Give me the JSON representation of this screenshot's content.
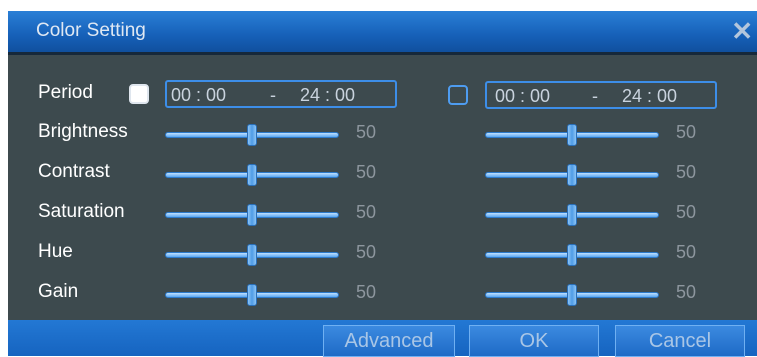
{
  "dialog": {
    "title": "Color Setting",
    "close_glyph": "✕"
  },
  "period": {
    "label": "Period"
  },
  "columns": [
    {
      "checked": true,
      "start": "00 : 00",
      "dash": "-",
      "end": "24 : 00"
    },
    {
      "checked": false,
      "start": "00 : 00",
      "dash": "-",
      "end": "24 : 00"
    }
  ],
  "settings": [
    {
      "label": "Brightness",
      "values": [
        50,
        50
      ]
    },
    {
      "label": "Contrast",
      "values": [
        50,
        50
      ]
    },
    {
      "label": "Saturation",
      "values": [
        50,
        50
      ]
    },
    {
      "label": "Hue",
      "values": [
        50,
        50
      ]
    },
    {
      "label": "Gain",
      "values": [
        50,
        50
      ]
    }
  ],
  "slider_range": [
    0,
    100
  ],
  "buttons": {
    "advanced": "Advanced",
    "ok": "OK",
    "cancel": "Cancel"
  }
}
